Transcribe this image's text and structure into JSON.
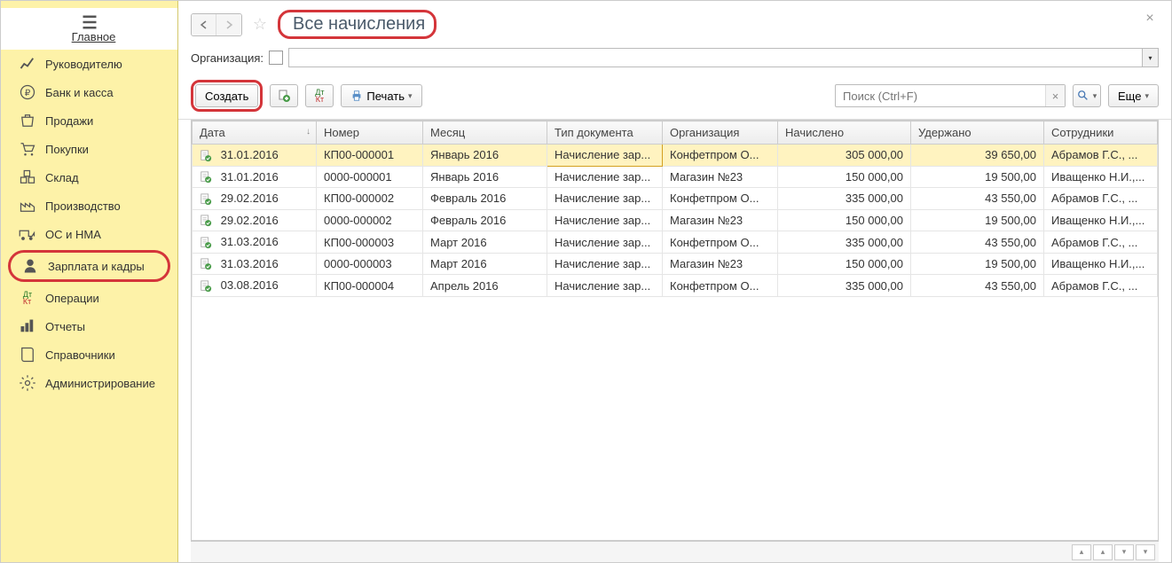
{
  "sidebar": {
    "items": [
      {
        "label": "Главное",
        "icon": "menu"
      },
      {
        "label": "Руководителю",
        "icon": "chart"
      },
      {
        "label": "Банк и касса",
        "icon": "ruble"
      },
      {
        "label": "Продажи",
        "icon": "bag"
      },
      {
        "label": "Покупки",
        "icon": "cart"
      },
      {
        "label": "Склад",
        "icon": "boxes"
      },
      {
        "label": "Производство",
        "icon": "factory"
      },
      {
        "label": "ОС и НМА",
        "icon": "truck"
      },
      {
        "label": "Зарплата и кадры",
        "icon": "person",
        "highlighted": true
      },
      {
        "label": "Операции",
        "icon": "dtkt"
      },
      {
        "label": "Отчеты",
        "icon": "bars"
      },
      {
        "label": "Справочники",
        "icon": "book"
      },
      {
        "label": "Администрирование",
        "icon": "gear"
      }
    ]
  },
  "header": {
    "title": "Все начисления",
    "org_label": "Организация:"
  },
  "toolbar": {
    "create_label": "Создать",
    "print_label": "Печать",
    "search_placeholder": "Поиск (Ctrl+F)",
    "more_label": "Еще"
  },
  "table": {
    "columns": [
      "Дата",
      "Номер",
      "Месяц",
      "Тип документа",
      "Организация",
      "Начислено",
      "Удержано",
      "Сотрудники"
    ],
    "rows": [
      {
        "date": "31.01.2016",
        "num": "КП00-000001",
        "month": "Январь 2016",
        "doctype": "Начисление зар...",
        "org": "Конфетпром О...",
        "accrued": "305 000,00",
        "withheld": "39 650,00",
        "emp": "Абрамов Г.С., ...",
        "selected": true
      },
      {
        "date": "31.01.2016",
        "num": "0000-000001",
        "month": "Январь 2016",
        "doctype": "Начисление зар...",
        "org": "Магазин №23",
        "accrued": "150 000,00",
        "withheld": "19 500,00",
        "emp": "Иващенко Н.И.,..."
      },
      {
        "date": "29.02.2016",
        "num": "КП00-000002",
        "month": "Февраль 2016",
        "doctype": "Начисление зар...",
        "org": "Конфетпром О...",
        "accrued": "335 000,00",
        "withheld": "43 550,00",
        "emp": "Абрамов Г.С., ..."
      },
      {
        "date": "29.02.2016",
        "num": "0000-000002",
        "month": "Февраль 2016",
        "doctype": "Начисление зар...",
        "org": "Магазин №23",
        "accrued": "150 000,00",
        "withheld": "19 500,00",
        "emp": "Иващенко Н.И.,..."
      },
      {
        "date": "31.03.2016",
        "num": "КП00-000003",
        "month": "Март 2016",
        "doctype": "Начисление зар...",
        "org": "Конфетпром О...",
        "accrued": "335 000,00",
        "withheld": "43 550,00",
        "emp": "Абрамов Г.С., ..."
      },
      {
        "date": "31.03.2016",
        "num": "0000-000003",
        "month": "Март 2016",
        "doctype": "Начисление зар...",
        "org": "Магазин №23",
        "accrued": "150 000,00",
        "withheld": "19 500,00",
        "emp": "Иващенко Н.И.,..."
      },
      {
        "date": "03.08.2016",
        "num": "КП00-000004",
        "month": "Апрель 2016",
        "doctype": "Начисление зар...",
        "org": "Конфетпром О...",
        "accrued": "335 000,00",
        "withheld": "43 550,00",
        "emp": "Абрамов Г.С., ..."
      }
    ]
  }
}
